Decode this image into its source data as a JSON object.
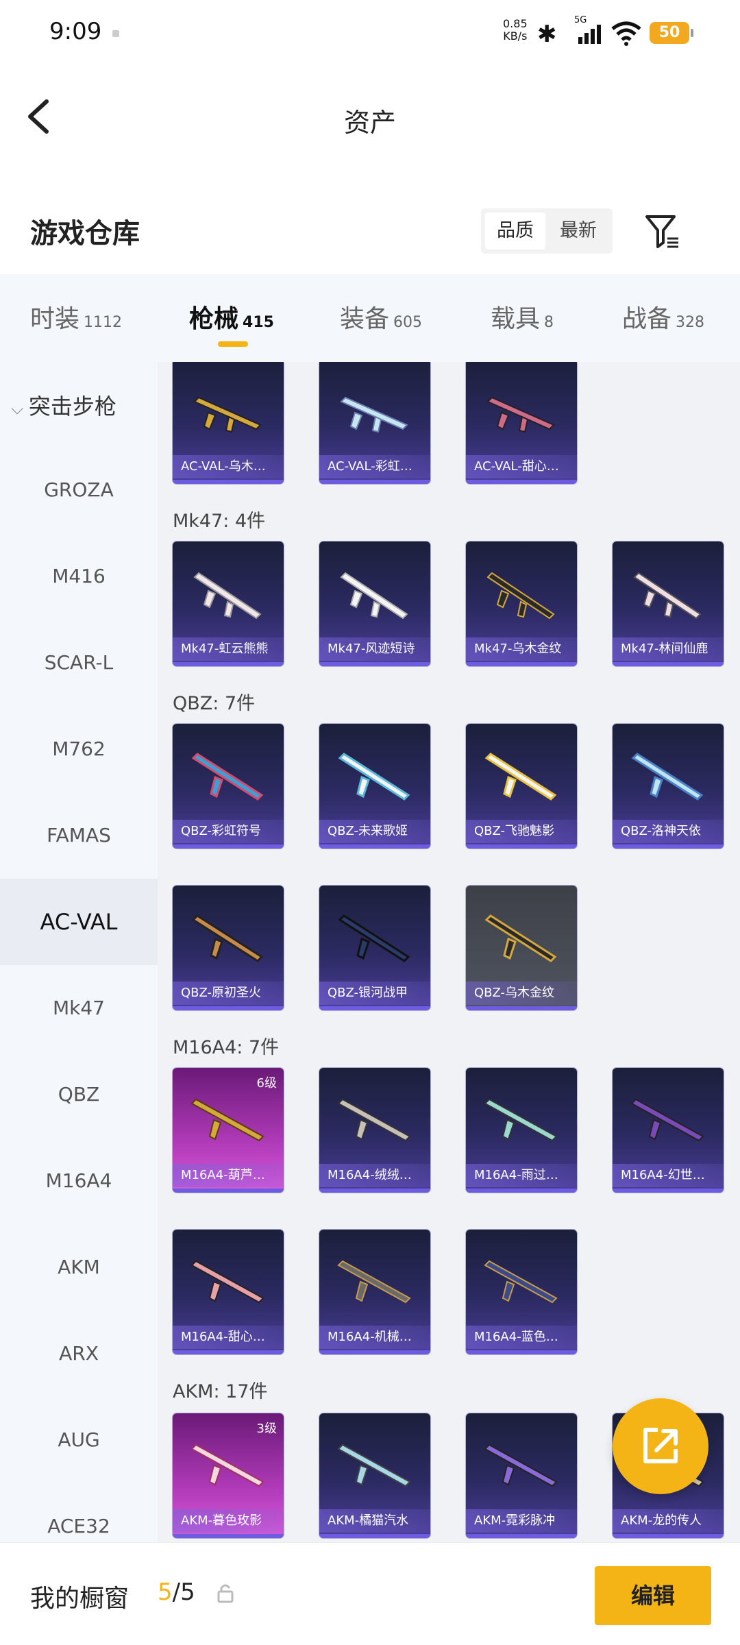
{
  "status_bar": {
    "time": "9:09",
    "net_speed": "0.85",
    "net_unit": "KB/s",
    "signal_label": "5G",
    "battery": "50"
  },
  "header": {
    "title": "资产",
    "back_icon": "chevron-left-icon"
  },
  "warehouse": {
    "title": "游戏仓库",
    "sort_options": [
      "品质",
      "最新"
    ],
    "active_sort": "品质",
    "filter_icon": "filter-icon"
  },
  "tabs": [
    {
      "label": "时装",
      "count": "1112"
    },
    {
      "label": "枪械",
      "count": "415",
      "active": true
    },
    {
      "label": "装备",
      "count": "605"
    },
    {
      "label": "载具",
      "count": "8"
    },
    {
      "label": "战备",
      "count": "328"
    }
  ],
  "sidebar": {
    "group": "突击步枪",
    "items": [
      "GROZA",
      "M416",
      "SCAR-L",
      "M762",
      "FAMAS",
      "AC-VAL",
      "Mk47",
      "QBZ",
      "M16A4",
      "AKM",
      "ARX",
      "AUG",
      "ACE32"
    ],
    "active": "AC-VAL"
  },
  "sections": {
    "acval_cards": [
      "AC-VAL-乌木…",
      "AC-VAL-彩虹…",
      "AC-VAL-甜心…"
    ],
    "mk47_label": "Mk47: 4件",
    "mk47_cards": [
      "Mk47-虹云熊熊",
      "Mk47-风迹短诗",
      "Mk47-乌木金纹",
      "Mk47-林间仙鹿"
    ],
    "qbz_label": "QBZ: 7件",
    "qbz_cards": [
      "QBZ-彩虹符号",
      "QBZ-未来歌姬",
      "QBZ-飞驰魅影",
      "QBZ-洛神天依",
      "QBZ-原初圣火",
      "QBZ-银河战甲",
      "QBZ-乌木金纹"
    ],
    "m16_label": "M16A4: 7件",
    "m16_cards": [
      "M16A4-葫芦…",
      "M16A4-绒绒…",
      "M16A4-雨过…",
      "M16A4-幻世…",
      "M16A4-甜心…",
      "M16A4-机械…",
      "M16A4-蓝色…"
    ],
    "m16_level": "6级",
    "akm_label": "AKM: 17件",
    "akm_cards": [
      "AKM-暮色玫影",
      "AKM-橘猫汽水",
      "AKM-霓彩脉冲",
      "AKM-龙的传人"
    ],
    "akm_level": "3级"
  },
  "share_icon": "share-icon",
  "bottom": {
    "title": "我的橱窗",
    "current": "5",
    "total": "/5",
    "lock_icon": "lock-icon",
    "edit_label": "编辑"
  }
}
